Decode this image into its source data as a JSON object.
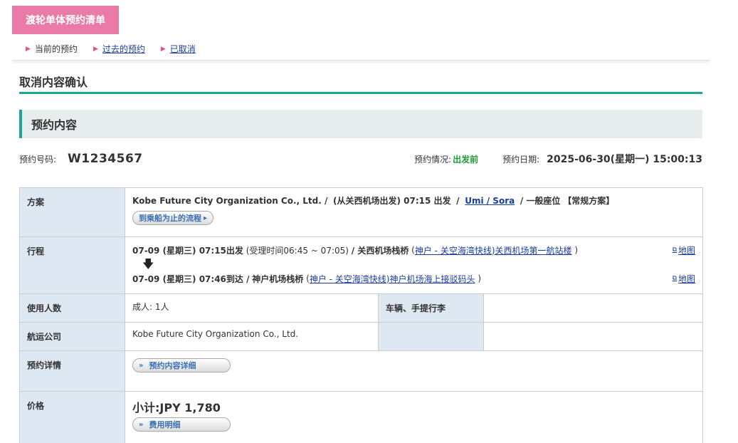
{
  "header": {
    "tab_title": "渡轮单体预约清单"
  },
  "subnav": {
    "items": [
      {
        "label": "当前的预约",
        "link": false
      },
      {
        "label": "过去的预约",
        "link": true
      },
      {
        "label": "已取消",
        "link": true
      }
    ]
  },
  "section": {
    "title": "取消内容确认",
    "subheader": "预约内容"
  },
  "reservation": {
    "number_label": "预约号码:",
    "number": "W1234567",
    "status_label": "预约情况:",
    "status": "出发前",
    "date_label": "预约日期:",
    "date": "2025-06-30(星期一) 15:00:13"
  },
  "table": {
    "plan": {
      "label": "方案",
      "company": "Kobe Future City Organization Co., Ltd. /",
      "depart_info": "(从关西机场出发) 07:15 出发",
      "sep": "/",
      "ship": "Umi / Sora",
      "seat": "/ 一般座位",
      "plan_type": "【常规方案】",
      "flow_button": "到乘船为止的流程"
    },
    "itinerary": {
      "label": "行程",
      "dep_datetime": "07-09 (星期三) 07:15出发",
      "dep_accept": "(受理时间06:45 ~ 07:05)",
      "dep_port": "/ 关西机场栈桥",
      "dep_paren_open": "(",
      "dep_link": "神户 - 关空海湾快线)关西机场第一航站楼",
      "dep_paren_close": ")",
      "arr_datetime": "07-09 (星期三) 07:46到达 /",
      "arr_port": "神户机场栈桥",
      "arr_paren_open": "(",
      "arr_link": "神户 - 关空海湾快线)神户机场海上接驳码头",
      "arr_paren_close": ")",
      "map_label": "地图",
      "map_label2": "地图",
      "arrow": "🡇"
    },
    "passengers": {
      "label": "使用人数",
      "value": "成人: 1人",
      "vehicle_label": "车辆、手提行李",
      "vehicle_value": ""
    },
    "carrier": {
      "label": "航运公司",
      "value": "Kobe Future City Organization Co., Ltd."
    },
    "details": {
      "label": "预约详情",
      "button": "预约内容详细"
    },
    "price": {
      "label": "价格",
      "subtotal": "小计:JPY 1,780",
      "button": "费用明细"
    }
  }
}
